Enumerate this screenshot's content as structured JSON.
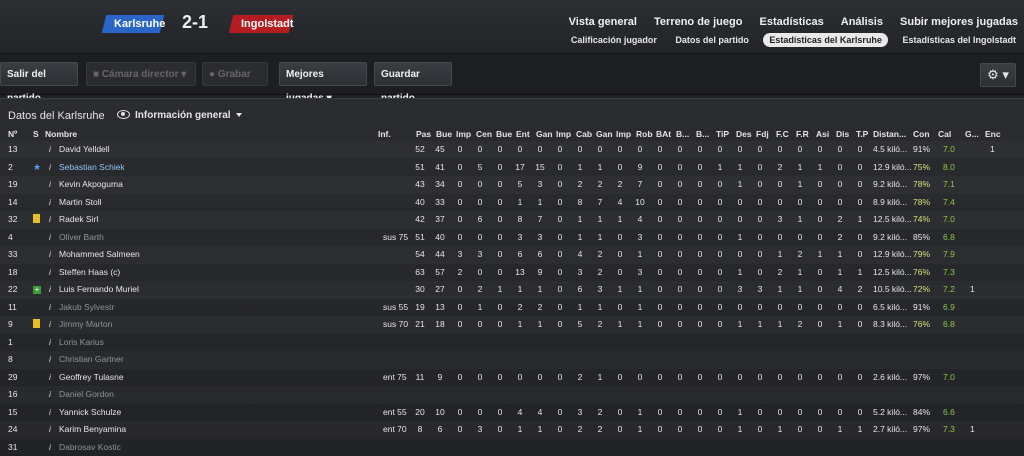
{
  "match": {
    "home_team": "Karlsruhe",
    "away_team": "Ingolstadt",
    "score": "2-1",
    "home_color": "#2a66c7",
    "away_color": "#b41c1f"
  },
  "nav_primary": [
    "Vista general",
    "Terreno de juego",
    "Estadísticas",
    "Análisis",
    "Subir mejores jugadas"
  ],
  "nav_secondary": [
    {
      "label": "Calificación jugador",
      "active": false
    },
    {
      "label": "Datos del partido",
      "active": false
    },
    {
      "label": "Estadísticas del Karlsruhe",
      "active": true
    },
    {
      "label": "Estadísticas del Ingolstadt",
      "active": false
    }
  ],
  "toolbar": {
    "exit": "Salir del partido",
    "camera": "Cámara director",
    "record": "Grabar",
    "highlights": "Mejores jugadas",
    "save": "Guardar partido"
  },
  "panel": {
    "title": "Datos del Karlsruhe",
    "view": "Información general"
  },
  "columns": [
    "Nº",
    "S",
    "Nombre",
    "Inf.",
    "Pas",
    "Bue",
    "Imp",
    "Cen",
    "Bue",
    "Ent",
    "Gan",
    "Imp",
    "Cab",
    "Gan",
    "Imp",
    "Rob",
    "BAt",
    "B...",
    "B...",
    "TiP",
    "Des",
    "Fdj",
    "F.C",
    "F.R",
    "Asi",
    "Dis",
    "T.P",
    "Distan...",
    "Con",
    "Cal",
    "G...",
    "Enc"
  ],
  "rows": [
    {
      "num": "13",
      "s": "",
      "name": "David Yelldell",
      "style": "",
      "inf": "",
      "vals": [
        "52",
        "45",
        "0",
        "0",
        "0",
        "0",
        "0",
        "0",
        "0",
        "0",
        "0",
        "0",
        "0",
        "0",
        "0",
        "0",
        "0",
        "0",
        "0",
        "0",
        "0",
        "0",
        "0"
      ],
      "dist": "4.5 kiló...",
      "con": "91%",
      "cal": "7.0",
      "g": "",
      "enc": "1"
    },
    {
      "num": "2",
      "s": "star",
      "name": "Sebastian Schiek",
      "style": "blue",
      "inf": "",
      "vals": [
        "51",
        "41",
        "0",
        "5",
        "0",
        "17",
        "15",
        "0",
        "1",
        "1",
        "0",
        "9",
        "0",
        "0",
        "0",
        "1",
        "1",
        "0",
        "2",
        "1",
        "1",
        "0",
        "0"
      ],
      "dist": "12.9 kiló...",
      "con": "75%",
      "cal": "8.0",
      "g": "",
      "enc": ""
    },
    {
      "num": "19",
      "s": "",
      "name": "Kevin Akpoguma",
      "style": "",
      "inf": "",
      "vals": [
        "43",
        "34",
        "0",
        "0",
        "0",
        "5",
        "3",
        "0",
        "2",
        "2",
        "2",
        "7",
        "0",
        "0",
        "0",
        "0",
        "1",
        "0",
        "0",
        "1",
        "0",
        "0",
        "0"
      ],
      "dist": "9.2 kiló...",
      "con": "78%",
      "cal": "7.1",
      "g": "",
      "enc": ""
    },
    {
      "num": "14",
      "s": "",
      "name": "Martin Stoll",
      "style": "",
      "inf": "",
      "vals": [
        "40",
        "33",
        "0",
        "0",
        "0",
        "1",
        "1",
        "0",
        "8",
        "7",
        "4",
        "10",
        "0",
        "0",
        "0",
        "0",
        "0",
        "0",
        "0",
        "0",
        "0",
        "0",
        "0"
      ],
      "dist": "8.9 kiló...",
      "con": "78%",
      "cal": "7.4",
      "g": "",
      "enc": ""
    },
    {
      "num": "32",
      "s": "yellow",
      "name": "Radek Sirl",
      "style": "",
      "inf": "",
      "vals": [
        "42",
        "37",
        "0",
        "6",
        "0",
        "8",
        "7",
        "0",
        "1",
        "1",
        "1",
        "4",
        "0",
        "0",
        "0",
        "0",
        "0",
        "0",
        "3",
        "1",
        "0",
        "2",
        "1"
      ],
      "dist": "12.5 kiló...",
      "con": "74%",
      "cal": "7.0",
      "g": "",
      "enc": ""
    },
    {
      "num": "4",
      "s": "",
      "name": "Oliver Barth",
      "style": "gray",
      "inf": "sus 75",
      "vals": [
        "51",
        "40",
        "0",
        "0",
        "0",
        "3",
        "3",
        "0",
        "1",
        "1",
        "0",
        "3",
        "0",
        "0",
        "0",
        "0",
        "1",
        "0",
        "0",
        "0",
        "0",
        "2",
        "0"
      ],
      "dist": "9.2 kiló...",
      "con": "85%",
      "cal": "6.8",
      "g": "",
      "enc": ""
    },
    {
      "num": "33",
      "s": "",
      "name": "Mohammed Salmeen",
      "style": "",
      "inf": "",
      "vals": [
        "54",
        "44",
        "3",
        "3",
        "0",
        "6",
        "6",
        "0",
        "4",
        "2",
        "0",
        "1",
        "0",
        "0",
        "0",
        "0",
        "0",
        "0",
        "1",
        "2",
        "1",
        "1",
        "0"
      ],
      "dist": "12.9 kiló...",
      "con": "79%",
      "cal": "7.9",
      "g": "",
      "enc": ""
    },
    {
      "num": "18",
      "s": "",
      "name": "Steffen Haas (c)",
      "style": "",
      "inf": "",
      "vals": [
        "63",
        "57",
        "2",
        "0",
        "0",
        "13",
        "9",
        "0",
        "3",
        "2",
        "0",
        "3",
        "0",
        "0",
        "0",
        "0",
        "1",
        "0",
        "2",
        "1",
        "0",
        "1",
        "1"
      ],
      "dist": "12.5 kiló...",
      "con": "76%",
      "cal": "7.3",
      "g": "",
      "enc": ""
    },
    {
      "num": "22",
      "s": "green",
      "name": "Luis Fernando Muriel",
      "style": "",
      "inf": "",
      "vals": [
        "30",
        "27",
        "0",
        "2",
        "1",
        "1",
        "1",
        "0",
        "6",
        "3",
        "1",
        "1",
        "0",
        "0",
        "0",
        "0",
        "3",
        "3",
        "1",
        "1",
        "0",
        "4",
        "2"
      ],
      "dist": "10.5 kiló...",
      "con": "72%",
      "cal": "7.2",
      "g": "1",
      "enc": ""
    },
    {
      "num": "11",
      "s": "",
      "name": "Jakub Sylvestr",
      "style": "gray",
      "inf": "sus 55",
      "vals": [
        "19",
        "13",
        "0",
        "1",
        "0",
        "2",
        "2",
        "0",
        "1",
        "1",
        "0",
        "1",
        "0",
        "0",
        "0",
        "0",
        "0",
        "0",
        "0",
        "0",
        "0",
        "0",
        "0"
      ],
      "dist": "6.5 kiló...",
      "con": "91%",
      "cal": "6.9",
      "g": "",
      "enc": ""
    },
    {
      "num": "9",
      "s": "yellow",
      "name": "Jimmy Marton",
      "style": "gray",
      "inf": "sus 70",
      "vals": [
        "21",
        "18",
        "0",
        "0",
        "0",
        "1",
        "1",
        "0",
        "5",
        "2",
        "1",
        "1",
        "0",
        "0",
        "0",
        "0",
        "1",
        "1",
        "1",
        "2",
        "0",
        "1",
        "0"
      ],
      "dist": "8.3 kiló...",
      "con": "76%",
      "cal": "6.8",
      "g": "",
      "enc": ""
    },
    {
      "num": "1",
      "s": "",
      "name": "Loris Karius",
      "style": "gray",
      "inf": "",
      "vals": [],
      "dist": "",
      "con": "",
      "cal": "",
      "g": "",
      "enc": ""
    },
    {
      "num": "8",
      "s": "",
      "name": "Christian Gartner",
      "style": "gray",
      "inf": "",
      "vals": [],
      "dist": "",
      "con": "",
      "cal": "",
      "g": "",
      "enc": ""
    },
    {
      "num": "29",
      "s": "",
      "name": "Geoffrey Tulasne",
      "style": "",
      "inf": "ent 75",
      "vals": [
        "11",
        "9",
        "0",
        "0",
        "0",
        "0",
        "0",
        "0",
        "2",
        "1",
        "0",
        "0",
        "0",
        "0",
        "0",
        "0",
        "0",
        "0",
        "0",
        "0",
        "0",
        "0",
        "0"
      ],
      "dist": "2.6 kiló...",
      "con": "97%",
      "cal": "7.0",
      "g": "",
      "enc": ""
    },
    {
      "num": "16",
      "s": "",
      "name": "Daniel Gordon",
      "style": "gray",
      "inf": "",
      "vals": [],
      "dist": "",
      "con": "",
      "cal": "",
      "g": "",
      "enc": ""
    },
    {
      "num": "15",
      "s": "",
      "name": "Yannick Schulze",
      "style": "",
      "inf": "ent 55",
      "vals": [
        "20",
        "10",
        "0",
        "0",
        "0",
        "4",
        "4",
        "0",
        "3",
        "2",
        "0",
        "1",
        "0",
        "0",
        "0",
        "0",
        "1",
        "0",
        "0",
        "0",
        "0",
        "0",
        "0"
      ],
      "dist": "5.2 kiló...",
      "con": "84%",
      "cal": "6.6",
      "g": "",
      "enc": ""
    },
    {
      "num": "24",
      "s": "",
      "name": "Karim Benyamina",
      "style": "",
      "inf": "ent 70",
      "vals": [
        "8",
        "6",
        "0",
        "3",
        "0",
        "1",
        "1",
        "0",
        "2",
        "2",
        "0",
        "1",
        "0",
        "0",
        "0",
        "0",
        "1",
        "0",
        "1",
        "0",
        "0",
        "1",
        "1"
      ],
      "dist": "2.7 kiló...",
      "con": "97%",
      "cal": "7.3",
      "g": "1",
      "enc": ""
    },
    {
      "num": "31",
      "s": "",
      "name": "Dabrosav Kostic",
      "style": "gray",
      "inf": "",
      "vals": [],
      "dist": "",
      "con": "",
      "cal": "",
      "g": "",
      "enc": ""
    }
  ]
}
